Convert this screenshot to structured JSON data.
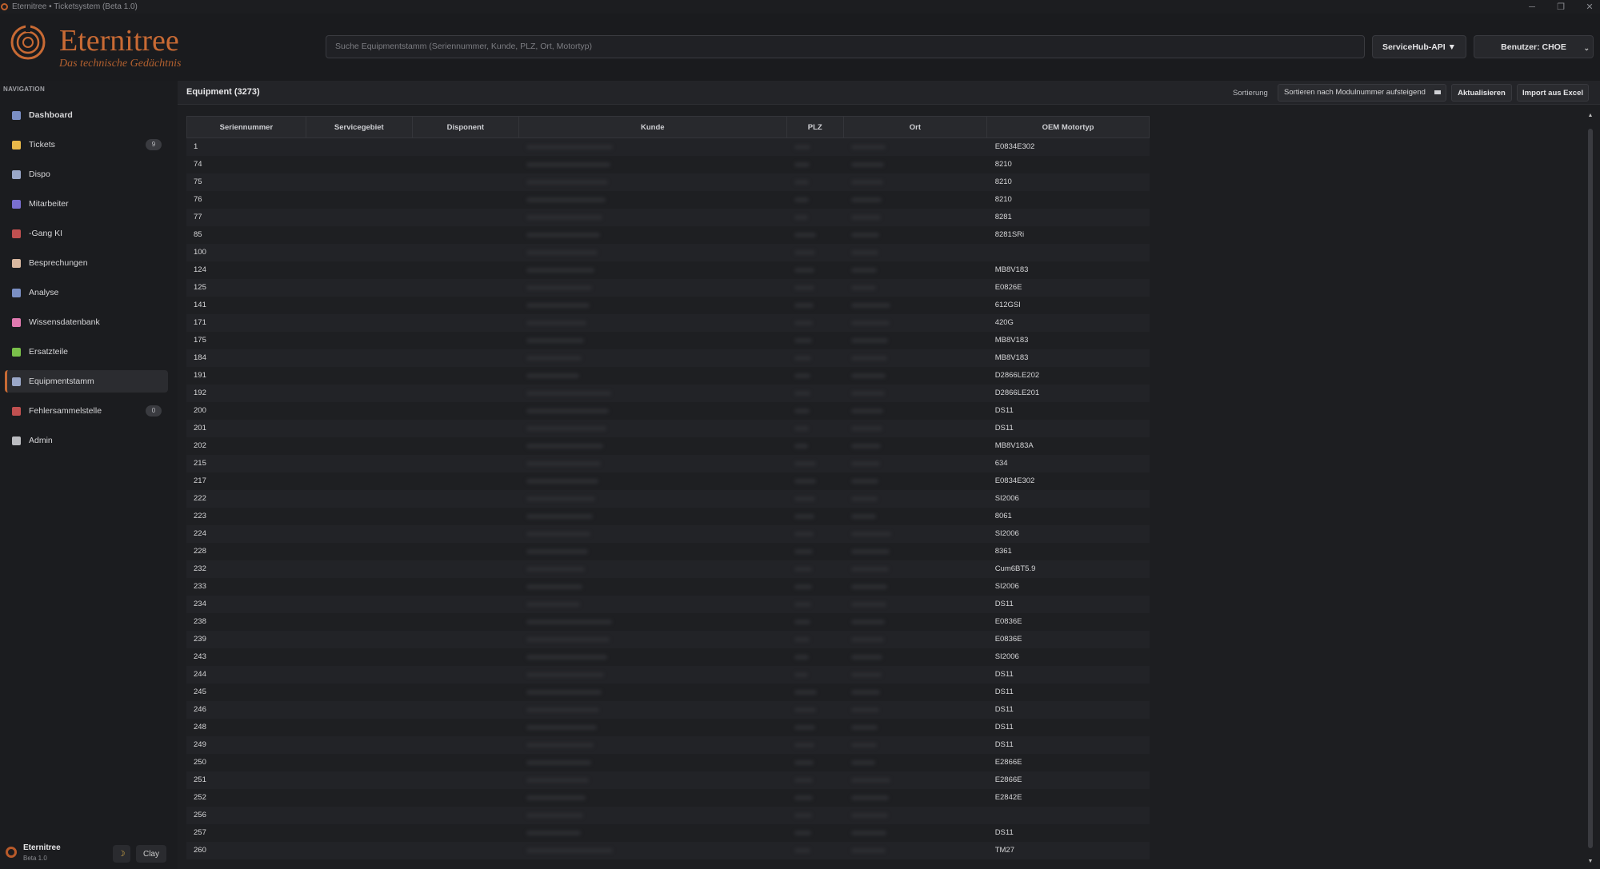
{
  "window": {
    "title": "Eternitree • Ticketsystem (Beta 1.0)",
    "controls": [
      "─",
      "❐",
      "✕"
    ]
  },
  "header": {
    "brand": "Eternitree",
    "tagline": "Das technische Gedächtnis",
    "search_placeholder": "Suche Equipmentstamm (Seriennummer, Kunde, PLZ, Ort, Motortyp)",
    "api_button": "ServiceHub-API ▼",
    "user_button": "Benutzer: CHOE"
  },
  "sidebar": {
    "heading": "NAVIGATION",
    "items": [
      {
        "label": "Dashboard",
        "icon": "dashboard-icon",
        "color": "#7b8fc4",
        "badge": ""
      },
      {
        "label": "Tickets",
        "icon": "ticket-icon",
        "color": "#e8b84a",
        "badge": "9"
      },
      {
        "label": "Dispo",
        "icon": "calendar-icon",
        "color": "#9aa7c8",
        "badge": ""
      },
      {
        "label": "Mitarbeiter",
        "icon": "person-icon",
        "color": "#7a6fd0",
        "badge": ""
      },
      {
        "label": "-Gang KI",
        "icon": "ai-icon",
        "color": "#c05050",
        "badge": ""
      },
      {
        "label": "Besprechungen",
        "icon": "notes-icon",
        "color": "#d9b8a0",
        "badge": ""
      },
      {
        "label": "Analyse",
        "icon": "chart-icon",
        "color": "#7b8fc4",
        "badge": ""
      },
      {
        "label": "Wissensdatenbank",
        "icon": "brain-icon",
        "color": "#e07ab0",
        "badge": ""
      },
      {
        "label": "Ersatzteile",
        "icon": "puzzle-icon",
        "color": "#7ac04a",
        "badge": ""
      },
      {
        "label": "Equipmentstamm",
        "icon": "folder-icon",
        "color": "#9aa7c8",
        "badge": ""
      },
      {
        "label": "Fehlersammelstelle",
        "icon": "bug-icon",
        "color": "#c05050",
        "badge": "0"
      },
      {
        "label": "Admin",
        "icon": "gear-icon",
        "color": "#bbbcc0",
        "badge": ""
      }
    ],
    "active_index": 9,
    "footer": {
      "name": "Eternitree",
      "version": "Beta 1.0",
      "theme_icon": "☽",
      "theme_button": "Clay"
    }
  },
  "toolbar": {
    "title": "Equipment (3273)",
    "sort_label": "Sortierung",
    "sort_value": "Sortieren nach Modulnummer aufsteigend",
    "refresh_button": "Aktualisieren",
    "import_button": "Import aus Excel"
  },
  "table": {
    "columns": [
      "Seriennummer",
      "Servicegebiet",
      "Disponent",
      "Kunde",
      "PLZ",
      "Ort",
      "OEM Motortyp"
    ],
    "rows": [
      {
        "serial": "1",
        "motor": "E0834E302"
      },
      {
        "serial": "74",
        "motor": "8210"
      },
      {
        "serial": "75",
        "motor": "8210"
      },
      {
        "serial": "76",
        "motor": "8210"
      },
      {
        "serial": "77",
        "motor": "8281"
      },
      {
        "serial": "85",
        "motor": "8281SRi"
      },
      {
        "serial": "100",
        "motor": ""
      },
      {
        "serial": "124",
        "motor": "MB8V183"
      },
      {
        "serial": "125",
        "motor": "E0826E"
      },
      {
        "serial": "141",
        "motor": "612GSI"
      },
      {
        "serial": "171",
        "motor": "420G"
      },
      {
        "serial": "175",
        "motor": "MB8V183"
      },
      {
        "serial": "184",
        "motor": "MB8V183"
      },
      {
        "serial": "191",
        "motor": "D2866LE202"
      },
      {
        "serial": "192",
        "motor": "D2866LE201"
      },
      {
        "serial": "200",
        "motor": "DS11"
      },
      {
        "serial": "201",
        "motor": "DS11"
      },
      {
        "serial": "202",
        "motor": "MB8V183A"
      },
      {
        "serial": "215",
        "motor": "634"
      },
      {
        "serial": "217",
        "motor": "E0834E302"
      },
      {
        "serial": "222",
        "motor": "SI2006"
      },
      {
        "serial": "223",
        "motor": "8061"
      },
      {
        "serial": "224",
        "motor": "SI2006"
      },
      {
        "serial": "228",
        "motor": "8361"
      },
      {
        "serial": "232",
        "motor": "Cum6BT5.9"
      },
      {
        "serial": "233",
        "motor": "SI2006"
      },
      {
        "serial": "234",
        "motor": "DS11"
      },
      {
        "serial": "238",
        "motor": "E0836E"
      },
      {
        "serial": "239",
        "motor": "E0836E"
      },
      {
        "serial": "243",
        "motor": "SI2006"
      },
      {
        "serial": "244",
        "motor": "DS11"
      },
      {
        "serial": "245",
        "motor": "DS11"
      },
      {
        "serial": "246",
        "motor": "DS11"
      },
      {
        "serial": "248",
        "motor": "DS11"
      },
      {
        "serial": "249",
        "motor": "DS11"
      },
      {
        "serial": "250",
        "motor": "E2866E"
      },
      {
        "serial": "251",
        "motor": "E2866E"
      },
      {
        "serial": "252",
        "motor": "E2842E"
      },
      {
        "serial": "256",
        "motor": ""
      },
      {
        "serial": "257",
        "motor": "DS11"
      },
      {
        "serial": "260",
        "motor": "TM27"
      }
    ]
  }
}
